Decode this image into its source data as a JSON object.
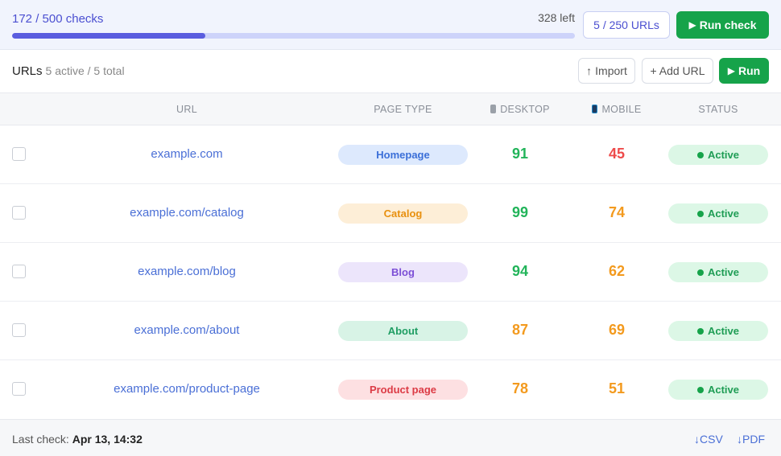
{
  "quota": {
    "label": "172 / 500 checks",
    "used_fraction": 0.344,
    "remaining": "328 left",
    "urls_badge": "5 / 250 URLs",
    "run_check": "Run check"
  },
  "section": {
    "title": "URLs",
    "subtitle": "5 active / 5 total",
    "import": "Import",
    "add_url": "+ Add URL",
    "run": "Run"
  },
  "columns": {
    "url": "URL",
    "page_type": "PAGE TYPE",
    "desktop": "DESKTOP",
    "mobile": "MOBILE",
    "status": "STATUS"
  },
  "rows": [
    {
      "url": "example.com",
      "type": "Homepage",
      "desktop": "91",
      "mobile": "45",
      "status": "Active"
    },
    {
      "url": "example.com/catalog",
      "type": "Catalog",
      "desktop": "99",
      "mobile": "74",
      "status": "Active"
    },
    {
      "url": "example.com/blog",
      "type": "Blog",
      "desktop": "94",
      "mobile": "62",
      "status": "Active"
    },
    {
      "url": "example.com/about",
      "type": "About",
      "desktop": "87",
      "mobile": "69",
      "status": "Active"
    },
    {
      "url": "example.com/product-page",
      "type": "Product page",
      "desktop": "78",
      "mobile": "51",
      "status": "Active"
    }
  ],
  "pill_colors": {
    "Homepage": {
      "bg": "#dde9fd",
      "fg": "#3b6fd8"
    },
    "Catalog": {
      "bg": "#fdeed7",
      "fg": "#e8900f"
    },
    "Blog": {
      "bg": "#ece5fb",
      "fg": "#7c4fd6"
    },
    "About": {
      "bg": "#d8f3e6",
      "fg": "#1f9d63"
    },
    "Product page": {
      "bg": "#fde0e2",
      "fg": "#dc3b45"
    }
  },
  "score_colors": {
    "good": "#22b45a",
    "average": "#f39a1e",
    "poor": "#ee4b4b"
  },
  "footer": {
    "last_check_label": "Last check:",
    "last_check_value": "Apr 13, 14:32",
    "csv": "CSV",
    "pdf": "PDF"
  },
  "icons": {
    "play": "play-icon",
    "import": "upload-arrow-icon",
    "desktop": "desktop-icon",
    "mobile": "mobile-icon",
    "download": "download-arrow-icon"
  }
}
